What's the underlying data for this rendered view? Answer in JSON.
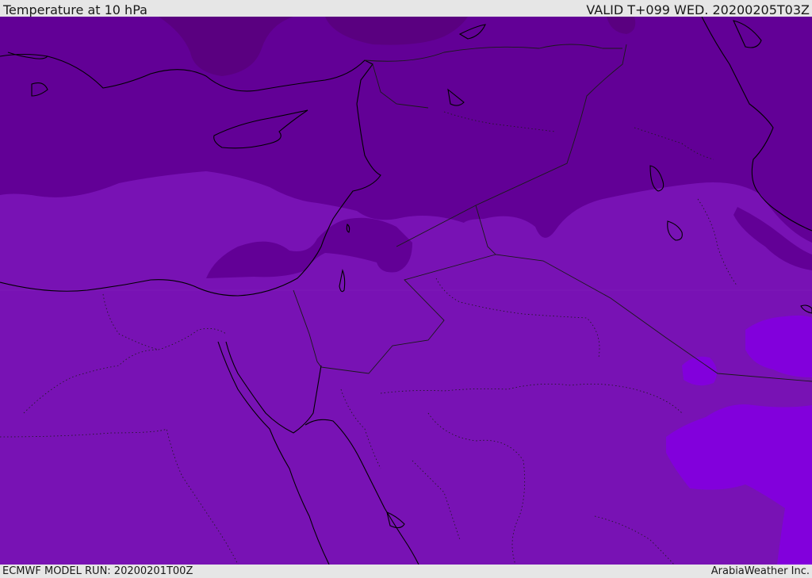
{
  "header": {
    "title": "Temperature at 10 hPa",
    "valid_time": "VALID T+099 WED. 20200205T03Z"
  },
  "footer": {
    "model_run": "ECMWF MODEL RUN: 20200201T00Z",
    "credit": "ArabiaWeather Inc."
  },
  "colors": {
    "band_coldest": "#5a0080",
    "band_cold": "#620096",
    "band_mid": "#7812b4",
    "band_warm": "#8200dc",
    "coastline": "#000000",
    "border": "#1a1a1a"
  }
}
